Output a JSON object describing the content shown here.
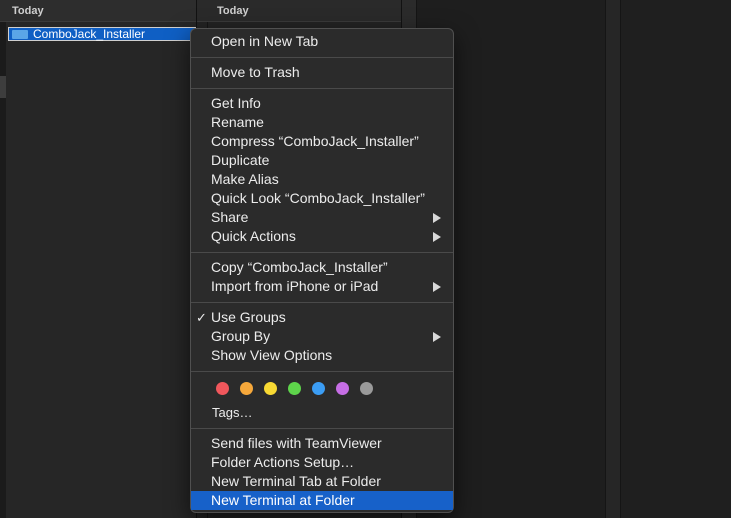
{
  "finder": {
    "col1_header": "Today",
    "col2_header": "Today",
    "selected_file": "ComboJack_Installer"
  },
  "menu": {
    "open_new_tab": "Open in New Tab",
    "move_to_trash": "Move to Trash",
    "get_info": "Get Info",
    "rename": "Rename",
    "compress": "Compress “ComboJack_Installer”",
    "duplicate": "Duplicate",
    "make_alias": "Make Alias",
    "quick_look": "Quick Look “ComboJack_Installer”",
    "share": "Share",
    "quick_actions": "Quick Actions",
    "copy": "Copy “ComboJack_Installer”",
    "import_iphone": "Import from iPhone or iPad",
    "use_groups": "Use Groups",
    "use_groups_check": "✓",
    "group_by": "Group By",
    "show_view_options": "Show View Options",
    "tags": "Tags…",
    "send_teamviewer": "Send files with TeamViewer",
    "folder_actions": "Folder Actions Setup…",
    "new_terminal_tab": "New Terminal Tab at Folder",
    "new_terminal": "New Terminal at Folder"
  },
  "tag_colors": {
    "red": "#f0575c",
    "orange": "#f6a83b",
    "yellow": "#f8d933",
    "green": "#5ed44b",
    "blue": "#3b9df4",
    "purple": "#c66ee5",
    "gray": "#9a9a9a"
  }
}
